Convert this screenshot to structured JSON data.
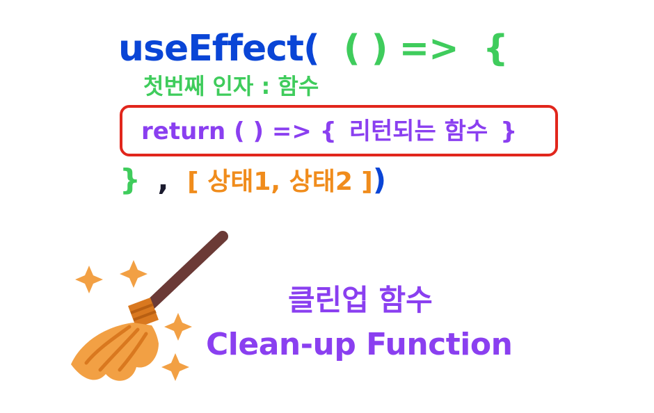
{
  "code": {
    "line1": {
      "fn_name": "useEffect(",
      "arrow": "( ) =>",
      "brace_open": "{"
    },
    "line2": {
      "comment": "첫번째 인자 : 함수"
    },
    "line3": {
      "return_kw": "return ( ) => {",
      "return_text": "리턴되는 함수",
      "brace_close": "}"
    },
    "line4": {
      "brace_close": "}",
      "comma": ",",
      "deps": "[ 상태1, 상태2 ]",
      "paren_close": ")"
    }
  },
  "caption": {
    "korean": "클린업 함수",
    "english": "Clean-up Function"
  },
  "colors": {
    "hook_blue": "#0a45d6",
    "fn_green": "#3fcc5c",
    "return_purple": "#8a3ff0",
    "deps_orange": "#f08c1c",
    "highlight_red": "#e1261c"
  },
  "icons": [
    "broom-icon",
    "sparkle-icon"
  ]
}
